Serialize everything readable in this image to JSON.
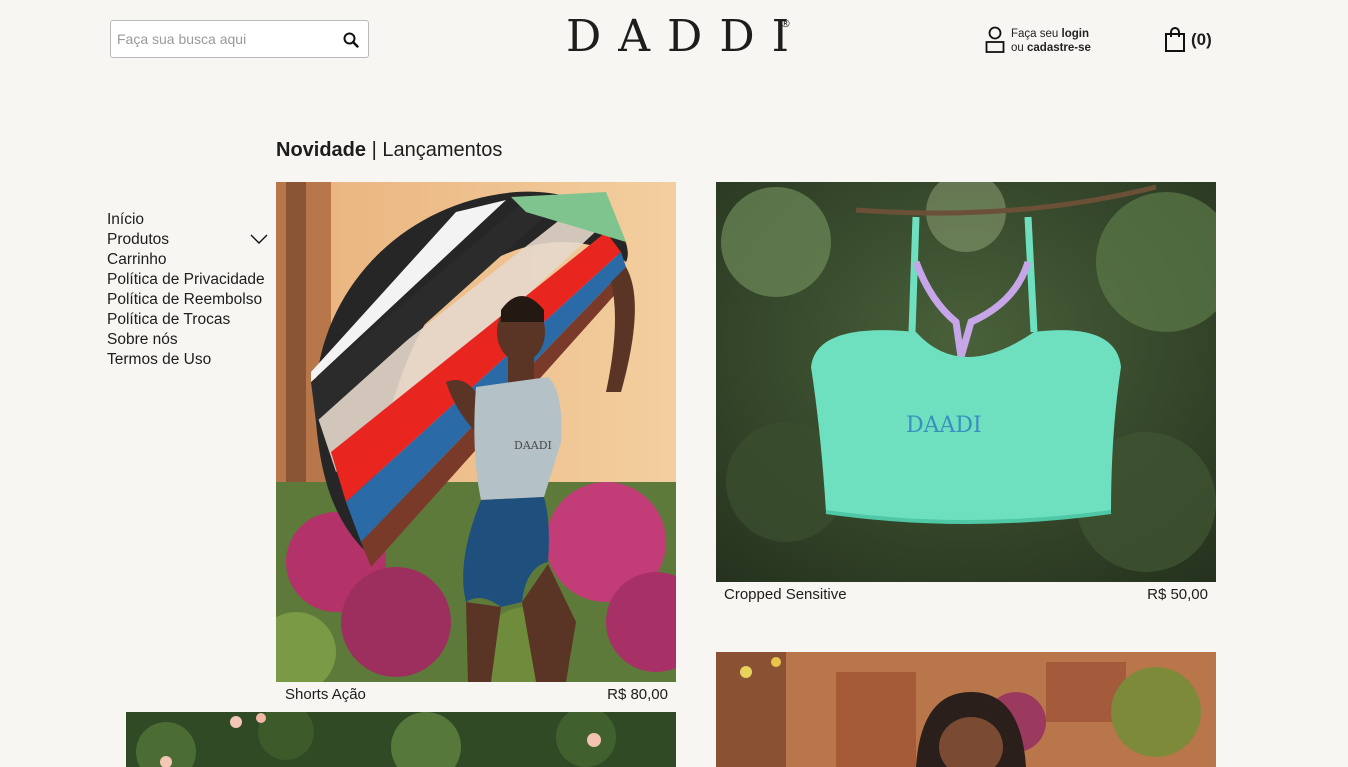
{
  "header": {
    "search_placeholder": "Faça sua busca aqui",
    "logo": "DADDI",
    "logo_mark": "®",
    "account_line1_prefix": "Faça seu ",
    "account_line1_link": "login",
    "account_line2_prefix": "ou ",
    "account_line2_link": "cadastre-se",
    "cart_count": "(0)"
  },
  "section": {
    "title_strong": "Novidade",
    "title_separator": " | ",
    "title_rest": "Lançamentos"
  },
  "sidenav": {
    "items": [
      {
        "label": "Início"
      },
      {
        "label": "Produtos"
      },
      {
        "label": "Carrinho"
      },
      {
        "label": "Política de Privacidade"
      },
      {
        "label": "Política de Reembolso"
      },
      {
        "label": "Política de Trocas"
      },
      {
        "label": "Sobre nós"
      },
      {
        "label": "Termos de Uso"
      }
    ]
  },
  "products": [
    {
      "name": "Shorts Ação",
      "price": "R$ 80,00",
      "image_text": "DAADI"
    },
    {
      "name": "Cropped Sensitive",
      "price": "R$ 50,00",
      "image_text": "DAADI"
    }
  ],
  "colors": {
    "background": "#f7f6f3",
    "text": "#1d1d1b",
    "mint": "#6ee0c0",
    "lilac": "#c6a6e8"
  }
}
